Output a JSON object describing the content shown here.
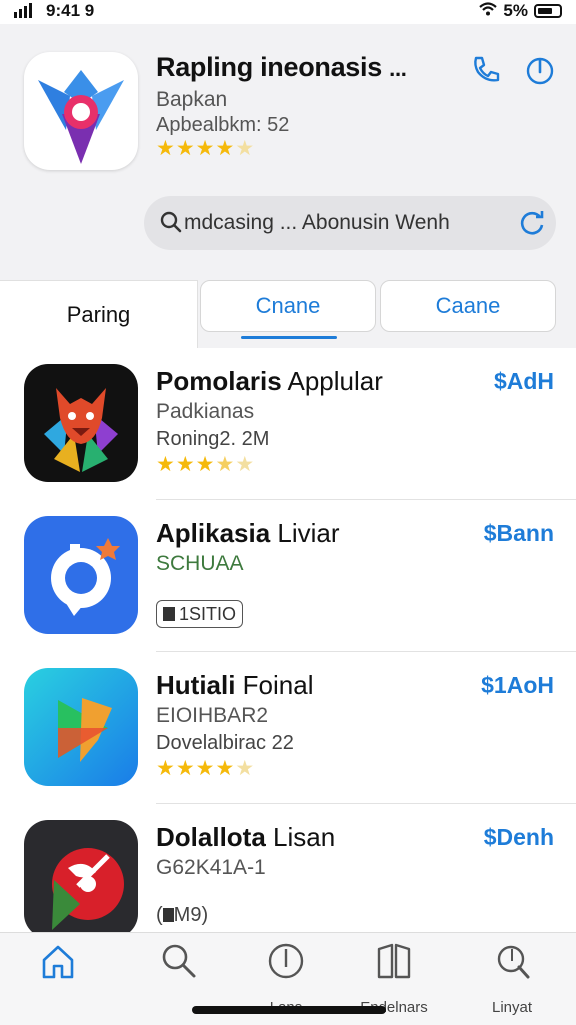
{
  "status_bar": {
    "time": "9:41 9",
    "battery_text": "5%"
  },
  "header": {
    "title": "Rapling ineonasis",
    "title_ellipsis": "...",
    "subtitle": "Bapkan",
    "meta": "Apbealbkm: 52",
    "rating_stars": 4,
    "accent_color": "#1e7cd8"
  },
  "search": {
    "value": "mdcasing ... Abonusin Wenh",
    "placeholder": "Search"
  },
  "tabs": [
    {
      "label": "Paring",
      "active": true
    },
    {
      "label": "Cnane",
      "active": false
    },
    {
      "label": "Caane",
      "active": false
    }
  ],
  "apps": [
    {
      "name_bold": "Pomolaris",
      "name_rest": " Applular",
      "line1": "Padkianas",
      "line2": "Roning2. 2M",
      "stars": 3.5,
      "price": "$AdH"
    },
    {
      "name_bold": "Aplikasia",
      "name_rest": " Liviar",
      "line1": "SCHUAA",
      "badge": "1SITIO",
      "price": "$Bann"
    },
    {
      "name_bold": "Hutiali",
      "name_rest": " Foinal",
      "line1": "EIOIHBAR2",
      "line2": "Dovelalbirac 22",
      "stars": 4,
      "price": "$1AoH"
    },
    {
      "name_bold": "Dolallota",
      "name_rest": " Lisan",
      "line1": "G62K41A-1",
      "badge": "M9",
      "price": "$Denh"
    }
  ],
  "tabbar": [
    {
      "label": "",
      "icon": "home-icon"
    },
    {
      "label": "",
      "icon": "search-icon"
    },
    {
      "label": "Lans",
      "icon": "clock-icon"
    },
    {
      "label": "Endelnars",
      "icon": "book-icon"
    },
    {
      "label": "Linyat",
      "icon": "search-alt-icon"
    }
  ]
}
